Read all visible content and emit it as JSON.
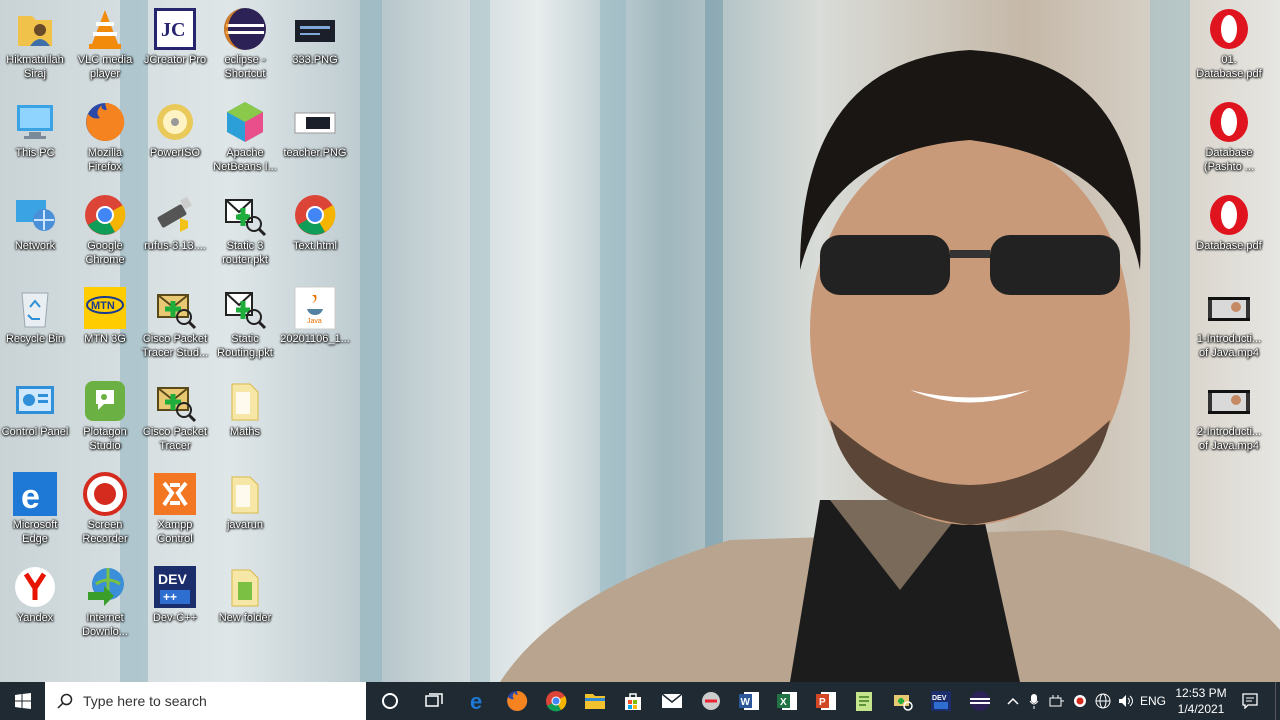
{
  "desktop": {
    "icons": [
      {
        "label": "Hikmatullah Siraj",
        "icon": "user-folder-icon"
      },
      {
        "label": "VLC media player",
        "icon": "vlc-icon"
      },
      {
        "label": "JCreator Pro",
        "icon": "jcreator-icon"
      },
      {
        "label": "eclipse - Shortcut",
        "icon": "eclipse-icon"
      },
      {
        "label": "333.PNG",
        "icon": "image-file-icon"
      },
      {
        "label": "This PC",
        "icon": "this-pc-icon"
      },
      {
        "label": "Mozilla Firefox",
        "icon": "firefox-icon"
      },
      {
        "label": "PowerISO",
        "icon": "poweriso-icon"
      },
      {
        "label": "Apache NetBeans I...",
        "icon": "netbeans-icon"
      },
      {
        "label": "teacher.PNG",
        "icon": "image-file-icon"
      },
      {
        "label": "Network",
        "icon": "network-icon"
      },
      {
        "label": "Google Chrome",
        "icon": "chrome-icon"
      },
      {
        "label": "rufus-3.13....",
        "icon": "usb-drive-icon"
      },
      {
        "label": "Static 3 router.pkt",
        "icon": "packet-tracer-file-icon"
      },
      {
        "label": "Text.html",
        "icon": "chrome-icon"
      },
      {
        "label": "Recycle Bin",
        "icon": "recycle-bin-icon"
      },
      {
        "label": "MTN 3G",
        "icon": "mtn-icon"
      },
      {
        "label": "Cisco Packet Tracer Stud...",
        "icon": "packet-tracer-icon"
      },
      {
        "label": "Static Routing.pkt",
        "icon": "packet-tracer-file-icon"
      },
      {
        "label": "20201106_1...",
        "icon": "java-file-icon"
      },
      {
        "label": "Control Panel",
        "icon": "control-panel-icon"
      },
      {
        "label": "Plotagon Studio",
        "icon": "plotagon-icon"
      },
      {
        "label": "Cisco Packet Tracer",
        "icon": "packet-tracer-icon"
      },
      {
        "label": "Maths",
        "icon": "folder-icon"
      },
      {
        "label": "Microsoft Edge",
        "icon": "edge-icon"
      },
      {
        "label": "Screen Recorder",
        "icon": "screen-recorder-icon"
      },
      {
        "label": "Xampp Control",
        "icon": "xampp-icon"
      },
      {
        "label": "javarun",
        "icon": "folder-icon"
      },
      {
        "label": "Yandex",
        "icon": "yandex-icon"
      },
      {
        "label": "Internet Downlo...",
        "icon": "idm-icon"
      },
      {
        "label": "Dev-C++",
        "icon": "devcpp-icon"
      },
      {
        "label": "New folder",
        "icon": "folder-icon"
      },
      {
        "label": "01. Database.pdf",
        "icon": "opera-pdf-icon"
      },
      {
        "label": "Database (Pashto ...",
        "icon": "opera-pdf-icon"
      },
      {
        "label": "Database.pdf",
        "icon": "opera-pdf-icon"
      },
      {
        "label": "1-Introducti... of Java.mp4",
        "icon": "video-file-icon"
      },
      {
        "label": "2-Introducti... of Java.mp4",
        "icon": "video-file-icon"
      }
    ]
  },
  "taskbar": {
    "search_placeholder": "Type here to search",
    "pinned": [
      "task-view-icon",
      "edge-icon",
      "firefox-icon",
      "chrome-icon",
      "file-explorer-icon",
      "store-icon",
      "mail-icon",
      "teams-icon",
      "word-icon",
      "excel-icon",
      "powerpoint-icon",
      "notepad-icon",
      "packet-tracer-icon",
      "devcpp-icon",
      "eclipse-icon"
    ],
    "tray": {
      "language": "ENG",
      "time": "12:53 PM",
      "date": "1/4/2021"
    }
  },
  "colors": {
    "taskbar_bg": "#1f2a33",
    "search_bg": "#ffffff"
  }
}
